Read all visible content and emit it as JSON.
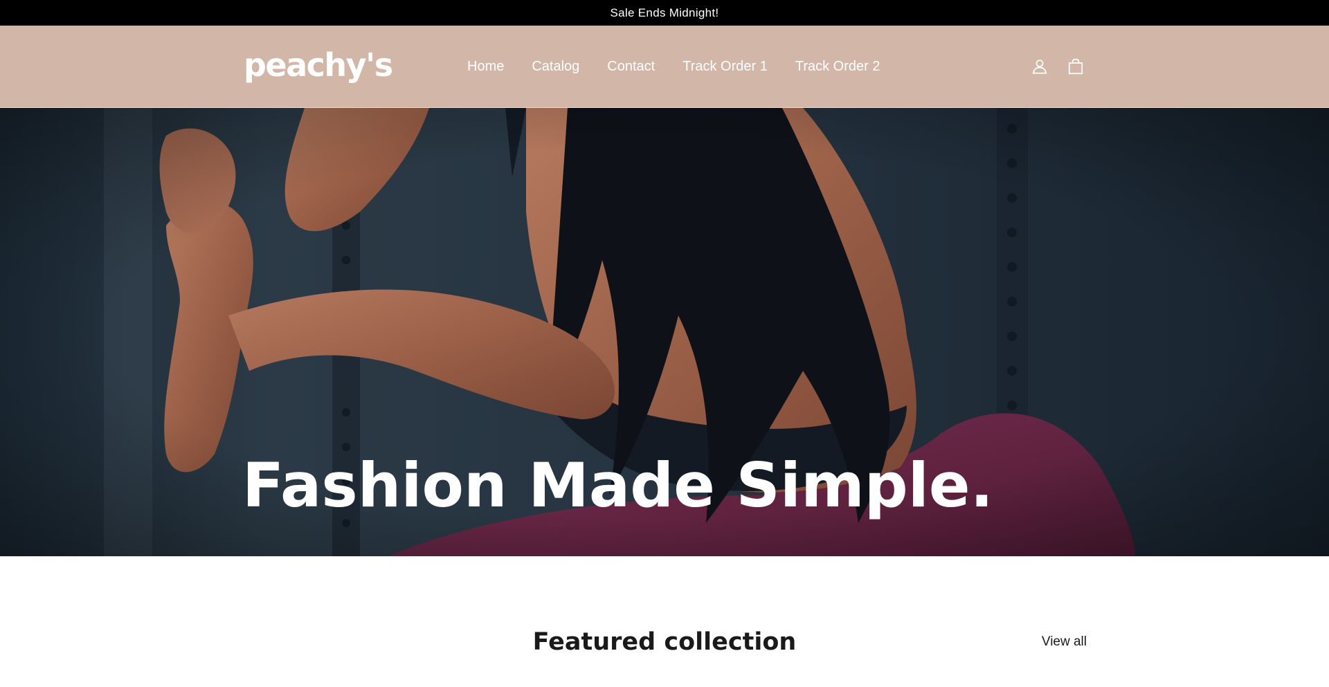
{
  "announcement": {
    "text": "Sale Ends Midnight!"
  },
  "header": {
    "logo": "peachy's",
    "nav": [
      {
        "label": "Home"
      },
      {
        "label": "Catalog"
      },
      {
        "label": "Contact"
      },
      {
        "label": "Track Order 1"
      },
      {
        "label": "Track Order 2"
      }
    ],
    "icons": [
      "account-icon",
      "cart-icon"
    ]
  },
  "hero": {
    "title": "Fashion Made Simple."
  },
  "featured": {
    "title": "Featured collection",
    "view_all": "View all"
  },
  "colors": {
    "announcement_bg": "#000000",
    "header_bg": "#d2b7a8",
    "hero_bg": "#243240",
    "legging": "#6a2646"
  }
}
